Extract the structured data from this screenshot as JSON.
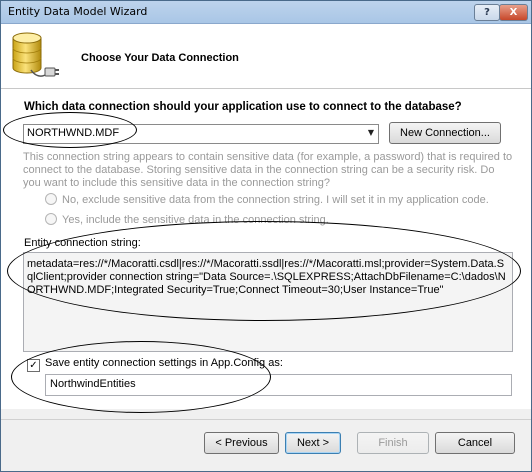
{
  "window": {
    "title": "Entity Data Model Wizard",
    "help_label": "?",
    "close_label": "X"
  },
  "header": {
    "title": "Choose Your Data Connection",
    "icon": "database-plug-icon"
  },
  "main": {
    "question": "Which data connection should your application use to connect to the database?",
    "connection_select": {
      "value": "NORTHWND.MDF",
      "arrow": "▼"
    },
    "new_connection_label": "New Connection...",
    "sensitive_text": "This connection string appears to contain sensitive data (for example, a password) that is required to connect to the database. Storing sensitive data in the connection string can be a security risk. Do you want to include this sensitive data in the connection string?",
    "radio_no_label": "No, exclude sensitive data from the connection string. I will set it in my application code.",
    "radio_yes_label": "Yes, include the sensitive data in the connection string.",
    "conn_string_label": "Entity connection string:",
    "conn_string_value": "metadata=res://*/Macoratti.csdl|res://*/Macoratti.ssdl|res://*/Macoratti.msl;provider=System.Data.SqlClient;provider connection string=\"Data Source=.\\SQLEXPRESS;AttachDbFilename=C:\\dados\\NORTHWND.MDF;Integrated Security=True;Connect Timeout=30;User Instance=True\"",
    "save_checkbox": {
      "checked": true,
      "label": "Save entity connection settings in App.Config as:"
    },
    "entities_name": "NorthwindEntities"
  },
  "footer": {
    "previous_label": "< Previous",
    "next_label": "Next >",
    "finish_label": "Finish",
    "cancel_label": "Cancel"
  },
  "colors": {
    "titlebar": "#bdd3ec",
    "disabled_text": "#9a9a9a",
    "close_button": "#c7472a"
  }
}
